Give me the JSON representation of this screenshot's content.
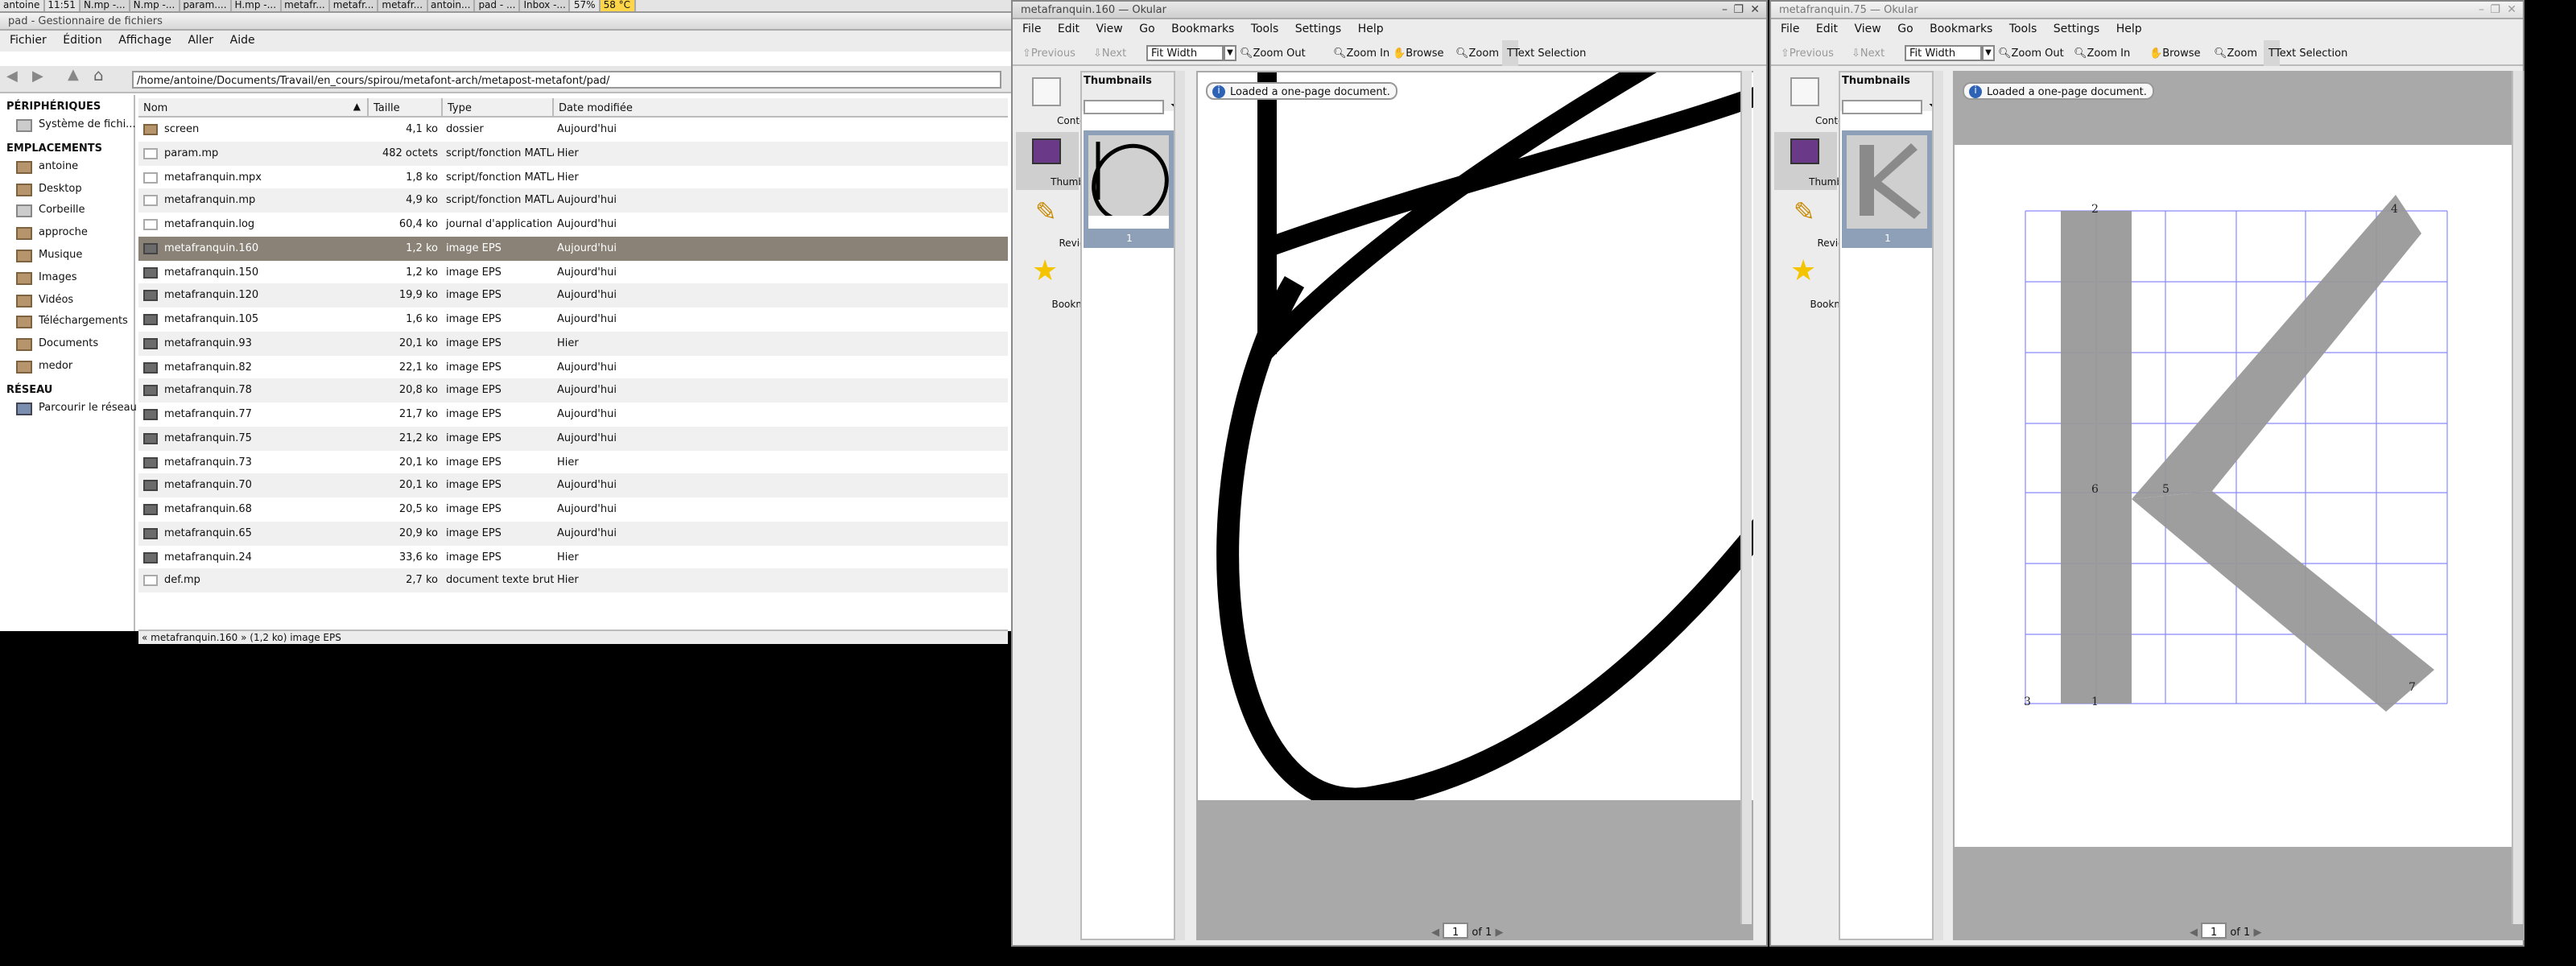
{
  "taskbar": {
    "user": "antoine",
    "time": "11:51",
    "tasks": [
      "N.mp -...",
      "N.mp -...",
      "param....",
      "H.mp -...",
      "metafr...",
      "metafr...",
      "metafr...",
      "antoin...",
      "pad - ...",
      "Inbox -..."
    ],
    "battery": "57%",
    "temp": "58 °C"
  },
  "nautilus": {
    "title": "pad - Gestionnaire de fichiers",
    "menu": [
      "Fichier",
      "Édition",
      "Affichage",
      "Aller",
      "Aide"
    ],
    "path": "/home/antoine/Documents/Travail/en_cours/spirou/metafont-arch/metapost-metafont/pad/",
    "sidebar": {
      "h_devices": "PÉRIPHÉRIQUES",
      "devices": [
        "Système de fichi..."
      ],
      "h_places": "EMPLACEMENTS",
      "places": [
        "antoine",
        "Desktop",
        "Corbeille",
        "approche",
        "Musique",
        "Images",
        "Vidéos",
        "Téléchargements",
        "Documents",
        "medor"
      ],
      "h_network": "RÉSEAU",
      "network": [
        "Parcourir le réseau"
      ]
    },
    "columns": {
      "name": "Nom",
      "size": "Taille",
      "type": "Type",
      "date": "Date modifiée"
    },
    "files": [
      {
        "name": "screen",
        "size": "4,1 ko",
        "type": "dossier",
        "date": "Aujourd'hui",
        "icon": "folder"
      },
      {
        "name": "param.mp",
        "size": "482 octets",
        "type": "script/fonction MATLAB",
        "date": "Hier",
        "icon": "txt"
      },
      {
        "name": "metafranquin.mpx",
        "size": "1,8 ko",
        "type": "script/fonction MATLAB",
        "date": "Hier",
        "icon": "txt"
      },
      {
        "name": "metafranquin.mp",
        "size": "4,9 ko",
        "type": "script/fonction MATLAB",
        "date": "Aujourd'hui",
        "icon": "txt"
      },
      {
        "name": "metafranquin.log",
        "size": "60,4 ko",
        "type": "journal d'application",
        "date": "Aujourd'hui",
        "icon": "txt"
      },
      {
        "name": "metafranquin.160",
        "size": "1,2 ko",
        "type": "image EPS",
        "date": "Aujourd'hui",
        "icon": "eps"
      },
      {
        "name": "metafranquin.150",
        "size": "1,2 ko",
        "type": "image EPS",
        "date": "Aujourd'hui",
        "icon": "eps"
      },
      {
        "name": "metafranquin.120",
        "size": "19,9 ko",
        "type": "image EPS",
        "date": "Aujourd'hui",
        "icon": "eps"
      },
      {
        "name": "metafranquin.105",
        "size": "1,6 ko",
        "type": "image EPS",
        "date": "Aujourd'hui",
        "icon": "eps"
      },
      {
        "name": "metafranquin.93",
        "size": "20,1 ko",
        "type": "image EPS",
        "date": "Hier",
        "icon": "eps"
      },
      {
        "name": "metafranquin.82",
        "size": "22,1 ko",
        "type": "image EPS",
        "date": "Aujourd'hui",
        "icon": "eps"
      },
      {
        "name": "metafranquin.78",
        "size": "20,8 ko",
        "type": "image EPS",
        "date": "Aujourd'hui",
        "icon": "eps"
      },
      {
        "name": "metafranquin.77",
        "size": "21,7 ko",
        "type": "image EPS",
        "date": "Aujourd'hui",
        "icon": "eps"
      },
      {
        "name": "metafranquin.75",
        "size": "21,2 ko",
        "type": "image EPS",
        "date": "Aujourd'hui",
        "icon": "eps"
      },
      {
        "name": "metafranquin.73",
        "size": "20,1 ko",
        "type": "image EPS",
        "date": "Hier",
        "icon": "eps"
      },
      {
        "name": "metafranquin.70",
        "size": "20,1 ko",
        "type": "image EPS",
        "date": "Aujourd'hui",
        "icon": "eps"
      },
      {
        "name": "metafranquin.68",
        "size": "20,5 ko",
        "type": "image EPS",
        "date": "Aujourd'hui",
        "icon": "eps"
      },
      {
        "name": "metafranquin.65",
        "size": "20,9 ko",
        "type": "image EPS",
        "date": "Aujourd'hui",
        "icon": "eps"
      },
      {
        "name": "metafranquin.24",
        "size": "33,6 ko",
        "type": "image EPS",
        "date": "Hier",
        "icon": "eps"
      },
      {
        "name": "def.mp",
        "size": "2,7 ko",
        "type": "document texte brut",
        "date": "Hier",
        "icon": "txt"
      }
    ],
    "selected_index": 5,
    "status": "« metafranquin.160 » (1,2 ko) image EPS"
  },
  "okular1": {
    "title": "metafranquin.160 — Okular"
  },
  "okular2": {
    "title": "metafranquin.75 — Okular"
  },
  "okular": {
    "menu": [
      "File",
      "Edit",
      "View",
      "Go",
      "Bookmarks",
      "Tools",
      "Settings",
      "Help"
    ],
    "toolbar": {
      "previous": "Previous",
      "next": "Next",
      "zoom_mode": "Fit Width",
      "zoom_out": "Zoom Out",
      "zoom_in": "Zoom In",
      "browse": "Browse",
      "zoom": "Zoom",
      "text_selection": "Text Selection"
    },
    "side": {
      "contents": "Contents",
      "thumbnails": "Thumbnails",
      "reviews": "Reviews",
      "bookmarks": "Bookmarks"
    },
    "thumbnails_header": "Thumbnails",
    "thumb_page": "1",
    "message": "Loaded a one-page document.",
    "page_current": "1",
    "page_of": "of",
    "page_total": "1"
  },
  "k_labels": [
    "2",
    "4",
    "6",
    "5",
    "3",
    "1",
    "7"
  ]
}
